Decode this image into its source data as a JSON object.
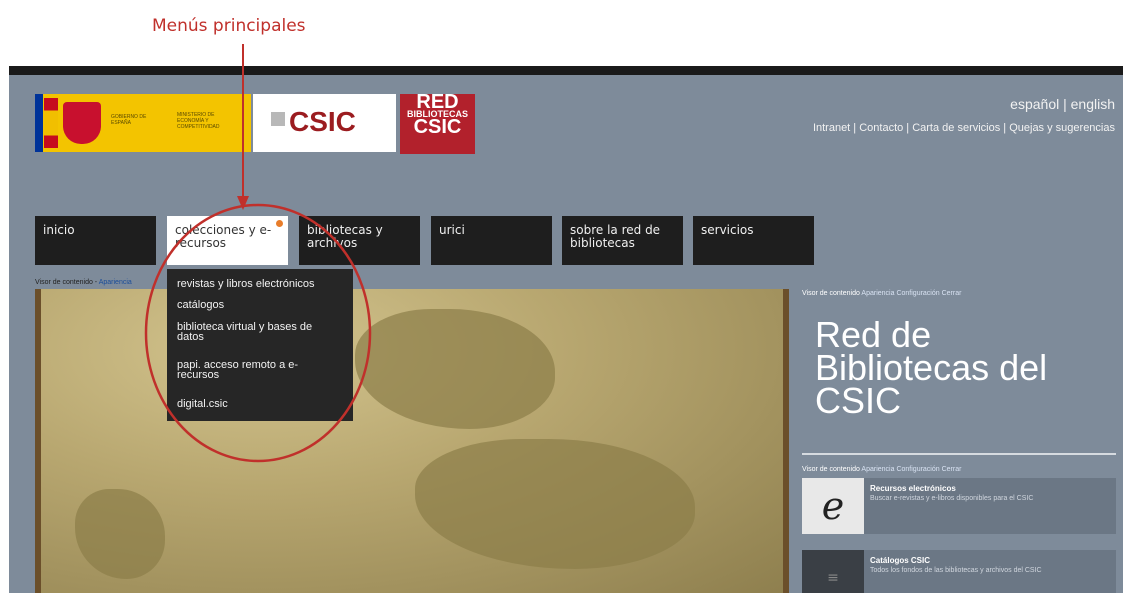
{
  "annotation": {
    "title": "Menús principales",
    "color": "#c0302b"
  },
  "header": {
    "gob_logo": {
      "line1": "GOBIERNO DE ESPAÑA",
      "line2": "MINISTERIO DE ECONOMÍA Y COMPETITIVIDAD"
    },
    "csic_logo": "CSIC",
    "red_logo": {
      "line1": "RED",
      "line2": "BIBLIOTECAS",
      "line3": "CSIC"
    },
    "lang": "español | english",
    "links": "Intranet | Contacto | Carta de servicios | Quejas y sugerencias"
  },
  "nav": {
    "items": [
      {
        "label": "inicio"
      },
      {
        "label": "colecciones y e-recursos"
      },
      {
        "label": "bibliotecas y archivos"
      },
      {
        "label": "urici"
      },
      {
        "label": "sobre la red de bibliotecas"
      },
      {
        "label": "servicios"
      }
    ],
    "active_index": 1
  },
  "dropdown": {
    "items": [
      "revistas y libros electrónicos",
      "catálogos",
      "biblioteca virtual y bases de datos",
      "papi. acceso remoto a e-recursos",
      "digital.csic"
    ]
  },
  "breadcrumb": {
    "text": "Visor de contenido - ",
    "link": "Apariencia"
  },
  "panel": {
    "links1": {
      "visor": "Visor de contenido",
      "apariencia": "Apariencia",
      "config": "Configuración",
      "cerrar": "Cerrar"
    },
    "title": "Red de Bibliotecas del CSIC",
    "links2": {
      "visor": "Visor de contenido",
      "apariencia": "Apariencia",
      "config": "Configuración",
      "cerrar": "Cerrar"
    },
    "resources": [
      {
        "icon": "e",
        "title": "Recursos electrónicos",
        "desc": "Buscar e-revistas y e-libros disponibles para el CSIC"
      },
      {
        "icon": "catalog-icon",
        "title": "Catálogos CSIC",
        "desc": "Todos los fondos de las bibliotecas y archivos del CSIC"
      }
    ]
  }
}
